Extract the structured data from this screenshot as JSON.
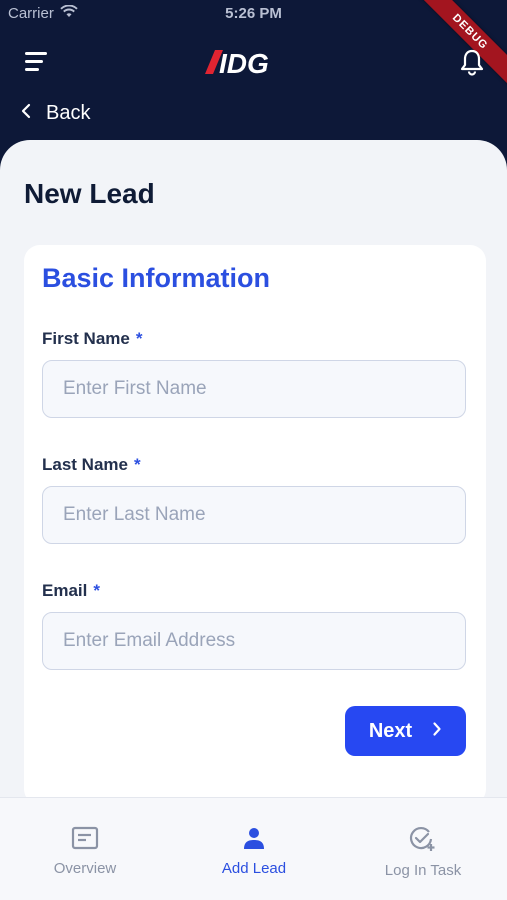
{
  "status_bar": {
    "carrier": "Carrier",
    "time": "5:26 PM",
    "debug_label": "DEBUG"
  },
  "app_bar": {
    "logo_text": "IDG",
    "menu_icon": "hamburger-menu-icon",
    "notification_icon": "bell-icon"
  },
  "nav": {
    "back_label": "Back"
  },
  "page": {
    "title": "New Lead"
  },
  "form": {
    "section_title": "Basic Information",
    "required_marker": "*",
    "fields": [
      {
        "label": "First Name",
        "placeholder": "Enter First Name",
        "value": ""
      },
      {
        "label": "Last Name",
        "placeholder": "Enter Last Name",
        "value": ""
      },
      {
        "label": "Email",
        "placeholder": "Enter Email Address",
        "value": ""
      }
    ],
    "next_label": "Next"
  },
  "bottom_nav": {
    "items": [
      {
        "label": "Overview",
        "icon": "overview-icon",
        "active": false
      },
      {
        "label": "Add Lead",
        "icon": "person-icon",
        "active": true
      },
      {
        "label": "Log In Task",
        "icon": "task-check-icon",
        "active": false
      }
    ]
  },
  "colors": {
    "header_bg": "#0d1838",
    "accent": "#2b4fe0",
    "button": "#2748f2",
    "debug_ribbon": "#a3151f"
  }
}
